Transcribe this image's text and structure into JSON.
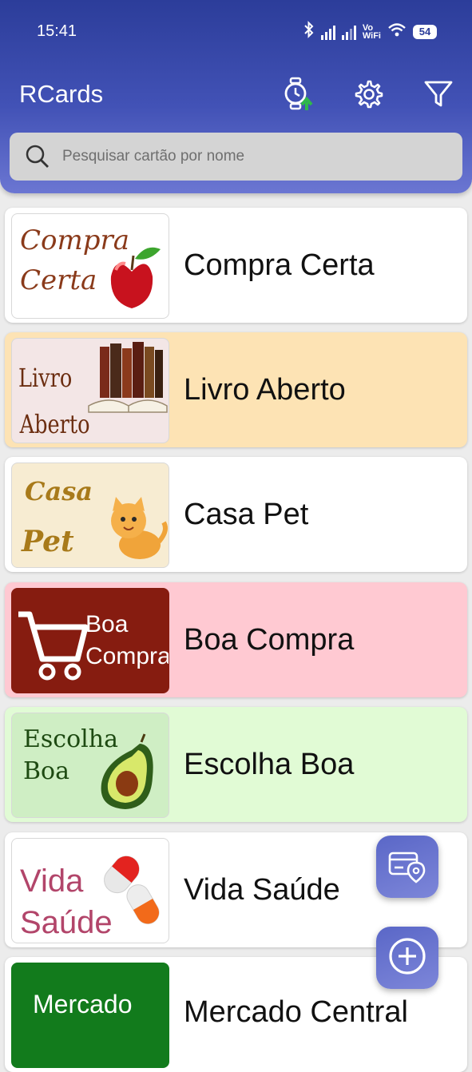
{
  "status_bar": {
    "time": "15:41",
    "vowifi": "Vo\nWiFi",
    "battery": "54"
  },
  "app_bar": {
    "title": "RCards"
  },
  "search": {
    "placeholder": "Pesquisar cartão por nome"
  },
  "cards": [
    {
      "name": "Compra Certa",
      "bg": "#ffffff",
      "thumb_text": [
        "Compra",
        "Certa"
      ]
    },
    {
      "name": "Livro Aberto",
      "bg": "#fde3b4",
      "thumb_text": [
        "Livro",
        "Aberto"
      ]
    },
    {
      "name": "Casa Pet",
      "bg": "#ffffff",
      "thumb_text": [
        "Casa",
        "Pet"
      ]
    },
    {
      "name": "Boa Compra",
      "bg": "#ffc9d2",
      "thumb_text": [
        "Boa",
        "Compra"
      ]
    },
    {
      "name": "Escolha Boa",
      "bg": "#e1fbd5",
      "thumb_text": [
        "Escolha",
        "Boa"
      ]
    },
    {
      "name": "Vida Saúde",
      "bg": "#ffffff",
      "thumb_text": [
        "Vida",
        "Saúde"
      ]
    },
    {
      "name": "Mercado Central",
      "bg": "#ffffff",
      "thumb_text": [
        "Mercado"
      ]
    }
  ],
  "colors": {
    "appbar": "#3d4fae",
    "fab": "#6470cd"
  },
  "icons": {
    "watch_sync": "watch-upload-icon",
    "settings": "gear-icon",
    "filter": "filter-icon",
    "nearby_cards": "card-location-icon",
    "add": "add-circle-icon"
  }
}
